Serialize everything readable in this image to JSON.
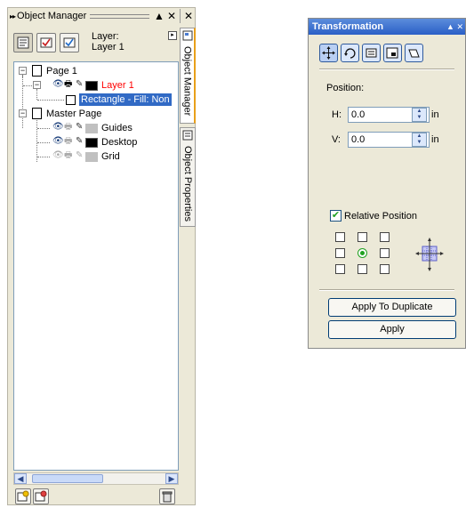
{
  "object_manager": {
    "title": "Object Manager",
    "title_controls": [
      "▲",
      "✕",
      "✕"
    ],
    "header": {
      "layer_label": "Layer:",
      "layer_value": "Layer 1",
      "toggle_buttons": [
        "show-object-properties-icon",
        "edit-across-layers-icon",
        "layer-manager-view-icon"
      ]
    },
    "tree": [
      {
        "label": "Page 1",
        "kind": "page",
        "expanded": true
      },
      {
        "label": "Layer 1",
        "kind": "layer",
        "color": "#ff0000",
        "swatch": "#000000"
      },
      {
        "label": "Rectangle - Fill: Non",
        "kind": "object",
        "selected": true
      },
      {
        "label": "Master Page",
        "kind": "page",
        "expanded": true
      },
      {
        "label": "Guides",
        "kind": "layer",
        "swatch": "#c0c0c0"
      },
      {
        "label": "Desktop",
        "kind": "layer",
        "swatch": "#000000"
      },
      {
        "label": "Grid",
        "kind": "layer",
        "swatch": "#c0c0c0",
        "dimmed": true
      }
    ],
    "side_tabs": [
      "Object Manager",
      "Object Properties"
    ],
    "footer_buttons": [
      "new-layer-icon",
      "new-master-layer-icon",
      "delete-icon"
    ]
  },
  "transformation": {
    "title": "Transformation",
    "title_controls": [
      "▲",
      "✕"
    ],
    "tool_buttons": [
      "position-icon",
      "rotate-icon",
      "scale-mirror-icon",
      "size-icon",
      "skew-icon"
    ],
    "position_label": "Position:",
    "h_label": "H:",
    "h_value": "0.0",
    "v_label": "V:",
    "v_value": "0.0",
    "unit": "in",
    "relative_position_label": "Relative Position",
    "relative_position_checked": true,
    "apply_to_duplicate_label": "Apply To Duplicate",
    "apply_label": "Apply"
  }
}
